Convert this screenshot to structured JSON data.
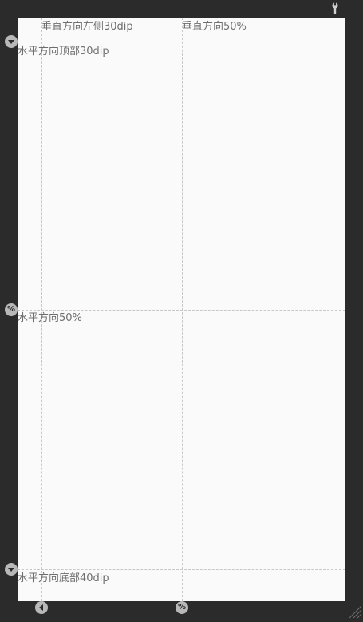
{
  "guides": {
    "vertical_left": {
      "label": "垂直方向左侧30dip"
    },
    "vertical_center": {
      "label": "垂直方向50%"
    },
    "horizontal_top": {
      "label": "水平方向顶部30dip"
    },
    "horizontal_center": {
      "label": "水平方向50%"
    },
    "horizontal_bottom": {
      "label": "水平方向底部40dip"
    }
  },
  "handles": {
    "percent_symbol": "%"
  },
  "icons": [
    "wrench-icon",
    "chevron-down-icon",
    "percent-icon",
    "chevron-left-icon",
    "resize-grip-icon"
  ],
  "colors": {
    "background": "#2b2b2c",
    "canvas": "#fafafa",
    "guide_line": "#c8c8c8",
    "label_text": "#6e6e6e",
    "handle": "#b8b8b8"
  }
}
